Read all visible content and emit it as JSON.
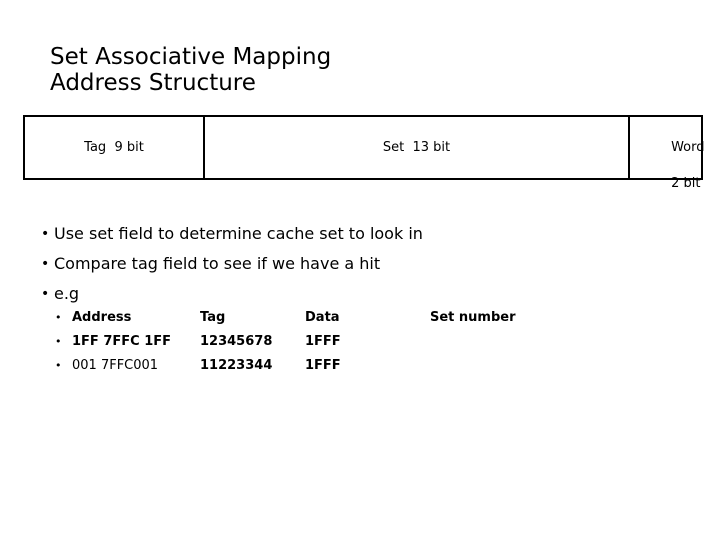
{
  "slide": {
    "title_lines": [
      "Set Associative Mapping",
      "Address Structure"
    ]
  },
  "address_structure_table": {
    "fields": [
      {
        "name": "tag",
        "label": "Tag  9 bit",
        "bits": 9
      },
      {
        "name": "set",
        "label": "Set  13 bit",
        "bits": 13
      },
      {
        "name": "word",
        "label_line1": "Word",
        "label_line2": "2 bit",
        "bits": 2
      }
    ]
  },
  "bullets": [
    {
      "marker": "•",
      "text": "Use set field to determine cache set to look in"
    },
    {
      "marker": "•",
      "text": "Compare tag field to see if we have a hit"
    },
    {
      "marker": "•",
      "text": "e.g"
    }
  ],
  "example_table": {
    "marker": "•",
    "header": {
      "address": "Address",
      "tag": "Tag",
      "data": "Data",
      "set_number": "Set number"
    },
    "rows": [
      {
        "address": "1FF 7FFC 1FF",
        "tag": "12345678",
        "data": "1FFF",
        "set_number": ""
      },
      {
        "address": "001 7FFC001",
        "tag": "11223344",
        "data": "1FFF",
        "set_number": ""
      }
    ]
  },
  "colors": {
    "background": "#ffffff",
    "text": "#000000",
    "table_border": "#000000"
  }
}
